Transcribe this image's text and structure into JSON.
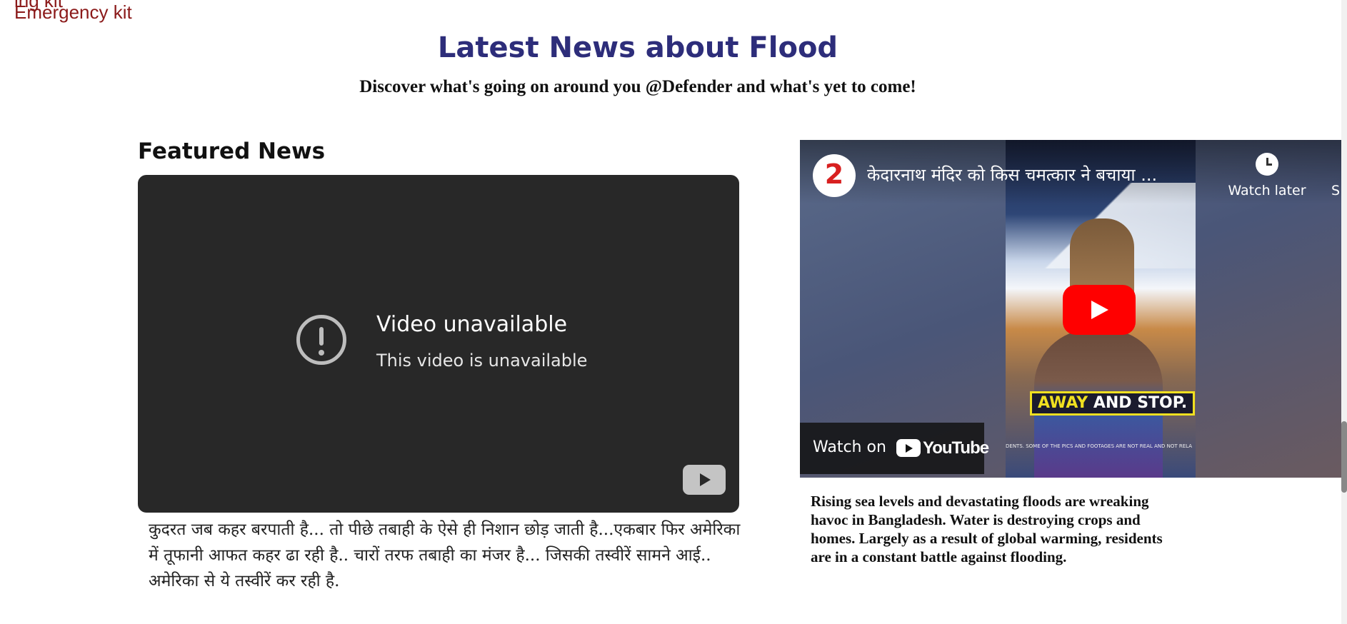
{
  "nav": {
    "emergency_kit_label": "Emergency kit",
    "cut_off_label": "ing kit"
  },
  "header": {
    "title": "Latest News about Flood",
    "subtitle": "Discover what's going on around you @Defender and what's yet to come!"
  },
  "featured": {
    "heading": "Featured News",
    "player": {
      "error_title": "Video unavailable",
      "error_message": "This video is unavailable",
      "icon": "exclamation-circle-icon"
    },
    "caption": "कुदरत जब कहर बरपाती है... तो पीछे तबाही के ऐसे ही निशान छोड़ जाती है...एकबार फिर अमेरिका में तूफानी आफत कहर ढा रही है.. चारों तरफ तबाही का मंजर है... जिसकी तस्वीरें सामने आई.. अमेरिका से ये तस्वीरें कर रही है."
  },
  "embed": {
    "video_title": "केदारनाथ मंदिर को किस चमत्कार ने बचाया ...",
    "channel_mark": "2",
    "watch_later_label": "Watch later",
    "share_label_cut": "S",
    "thumbnail_banner": {
      "word1": "AWAY",
      "word2": "AND STOP."
    },
    "thumbnail_disclaimer": "DENTS. SOME OF THE PICS AND FOOTAGES ARE NOT REAL AND NOT RELA",
    "watch_on_label": "Watch on",
    "youtube_wordmark": "YouTube",
    "play_icon": "play-icon",
    "brand_color": "#ff0000"
  },
  "right_caption": "Rising sea levels and devastating floods are wreaking havoc in Bangladesh. Water is destroying crops and homes. Largely as a result of global warming, residents are in a constant battle against flooding."
}
